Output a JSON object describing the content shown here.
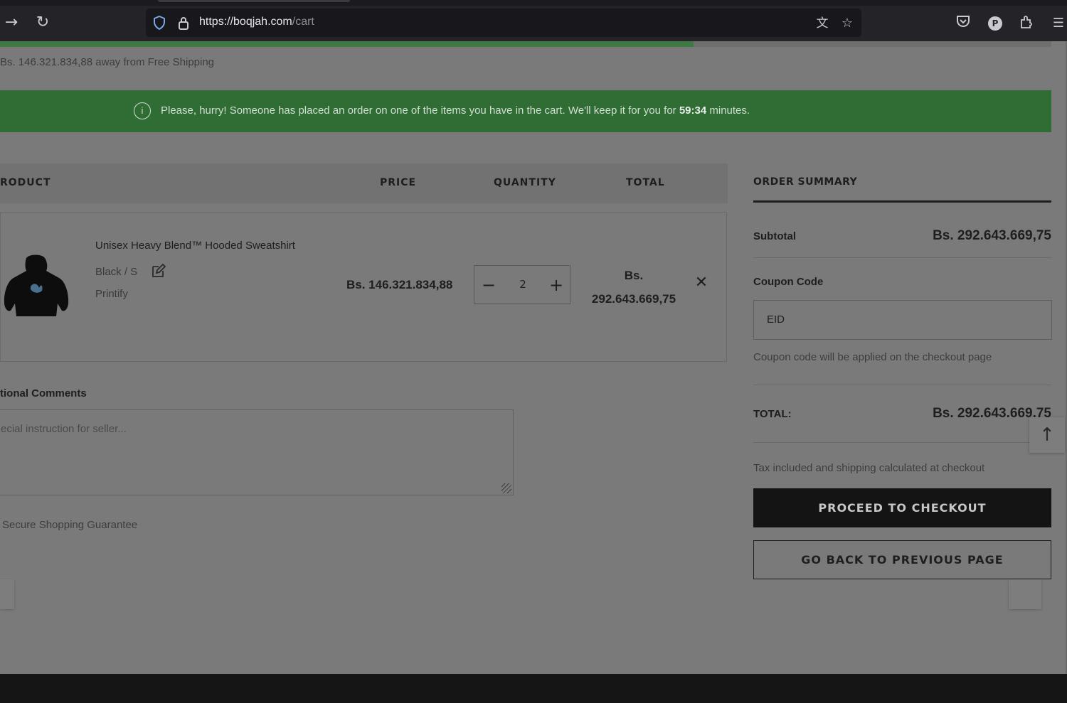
{
  "browser": {
    "url_host": "https://boqjah.com",
    "url_path": "/cart",
    "icons": [
      "forward-icon",
      "reload-icon",
      "shield-icon",
      "lock-icon",
      "translate-icon",
      "bookmark-star-icon",
      "pocket-icon",
      "profile-icon",
      "extensions-icon",
      "menu-icon"
    ],
    "profile_initial": "P"
  },
  "shipping": {
    "message": "Bs. 146.321.834,88 away from Free Shipping",
    "progress_fraction": 0.66
  },
  "alert": {
    "text_before": "Please, hurry! Someone has placed an order on one of the items you have in the cart. We'll keep it for you for ",
    "timer": "59:34",
    "text_after": " minutes."
  },
  "cart": {
    "headers": {
      "product": "RODUCT",
      "price": "PRICE",
      "quantity": "QUANTITY",
      "total": "TOTAL"
    },
    "items": [
      {
        "title": "Unisex Heavy Blend™ Hooded Sweatshirt",
        "variant": "Black / S",
        "vendor": "Printify",
        "price": "Bs. 146.321.834,88",
        "quantity": "2",
        "total_line1": "Bs.",
        "total_line2": "292.643.669,75"
      }
    ]
  },
  "comments": {
    "label": "tional Comments",
    "placeholder": "ecial instruction for seller..."
  },
  "secure": {
    "text": "Secure Shopping Guarantee"
  },
  "summary": {
    "title": "ORDER SUMMARY",
    "subtotal_label": "Subtotal",
    "subtotal_value": "Bs. 292.643.669,75",
    "coupon_label": "Coupon Code",
    "coupon_value": "EID",
    "coupon_note": "Coupon code will be applied on the checkout page",
    "total_label": "TOTAL:",
    "total_value": "Bs. 292.643.669,75",
    "tax_note": "Tax included and shipping calculated at checkout",
    "checkout_button": "PROCEED TO CHECKOUT",
    "back_button": "GO BACK TO PREVIOUS PAGE"
  },
  "colors": {
    "overlay_dim": "#7a7a7a",
    "alert_green": "#2f6d35",
    "progress_green": "#3f7a45",
    "primary_button": "#141414"
  }
}
